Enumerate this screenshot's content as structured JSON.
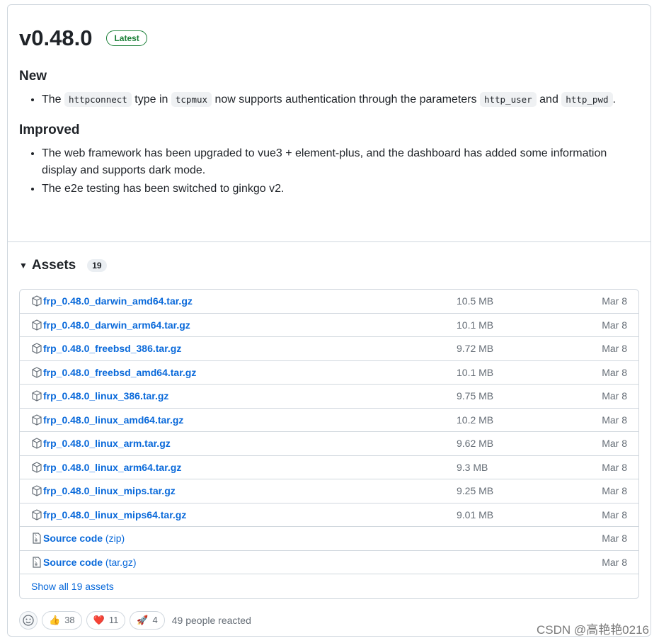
{
  "release": {
    "title": "v0.48.0",
    "badge": "Latest"
  },
  "notes": {
    "new_heading": "New",
    "new_item": {
      "t1": "The",
      "c1": "httpconnect",
      "t2": "type in",
      "c2": "tcpmux",
      "t3": "now supports authentication through the parameters",
      "c3": "http_user",
      "t4": "and",
      "c4": "http_pwd",
      "t5": "."
    },
    "improved_heading": "Improved",
    "improved_items": [
      "The web framework has been upgraded to vue3 + element-plus, and the dashboard has added some information display and supports dark mode.",
      "The e2e testing has been switched to ginkgo v2."
    ]
  },
  "assets": {
    "title": "Assets",
    "count": "19",
    "items": [
      {
        "icon": "package-icon",
        "name": "frp_0.48.0_darwin_amd64.tar.gz",
        "size": "10.5 MB",
        "date": "Mar 8"
      },
      {
        "icon": "package-icon",
        "name": "frp_0.48.0_darwin_arm64.tar.gz",
        "size": "10.1 MB",
        "date": "Mar 8"
      },
      {
        "icon": "package-icon",
        "name": "frp_0.48.0_freebsd_386.tar.gz",
        "size": "9.72 MB",
        "date": "Mar 8"
      },
      {
        "icon": "package-icon",
        "name": "frp_0.48.0_freebsd_amd64.tar.gz",
        "size": "10.1 MB",
        "date": "Mar 8"
      },
      {
        "icon": "package-icon",
        "name": "frp_0.48.0_linux_386.tar.gz",
        "size": "9.75 MB",
        "date": "Mar 8"
      },
      {
        "icon": "package-icon",
        "name": "frp_0.48.0_linux_amd64.tar.gz",
        "size": "10.2 MB",
        "date": "Mar 8"
      },
      {
        "icon": "package-icon",
        "name": "frp_0.48.0_linux_arm.tar.gz",
        "size": "9.62 MB",
        "date": "Mar 8"
      },
      {
        "icon": "package-icon",
        "name": "frp_0.48.0_linux_arm64.tar.gz",
        "size": "9.3 MB",
        "date": "Mar 8"
      },
      {
        "icon": "package-icon",
        "name": "frp_0.48.0_linux_mips.tar.gz",
        "size": "9.25 MB",
        "date": "Mar 8"
      },
      {
        "icon": "package-icon",
        "name": "frp_0.48.0_linux_mips64.tar.gz",
        "size": "9.01 MB",
        "date": "Mar 8"
      },
      {
        "icon": "file-zip-icon",
        "name": "Source code",
        "paren": "(zip)",
        "size": "",
        "date": "Mar 8"
      },
      {
        "icon": "file-zip-icon",
        "name": "Source code",
        "paren": "(tar.gz)",
        "size": "",
        "date": "Mar 8"
      }
    ],
    "show_all": "Show all 19 assets"
  },
  "reactions": {
    "items": [
      {
        "emoji": "👍",
        "name": "thumbs-up",
        "count": "38"
      },
      {
        "emoji": "❤️",
        "name": "heart",
        "count": "11"
      },
      {
        "emoji": "🚀",
        "name": "rocket",
        "count": "4"
      }
    ],
    "summary": "49 people reacted"
  },
  "watermark": "CSDN @高艳艳0216"
}
